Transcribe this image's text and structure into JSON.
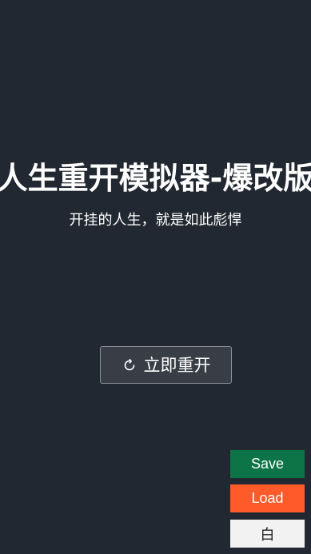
{
  "app": {
    "title": "人生重开模拟器-爆改版",
    "subtitle": "开挂的人生，就是如此彪悍"
  },
  "main": {
    "restart_label": "立即重开",
    "restart_icon": "refresh-icon"
  },
  "side_buttons": {
    "save_label": "Save",
    "load_label": "Load",
    "theme_label": "白"
  },
  "colors": {
    "background": "#222831",
    "save": "#0d7447",
    "load": "#ff5a2a",
    "theme": "#f2f2f2"
  }
}
